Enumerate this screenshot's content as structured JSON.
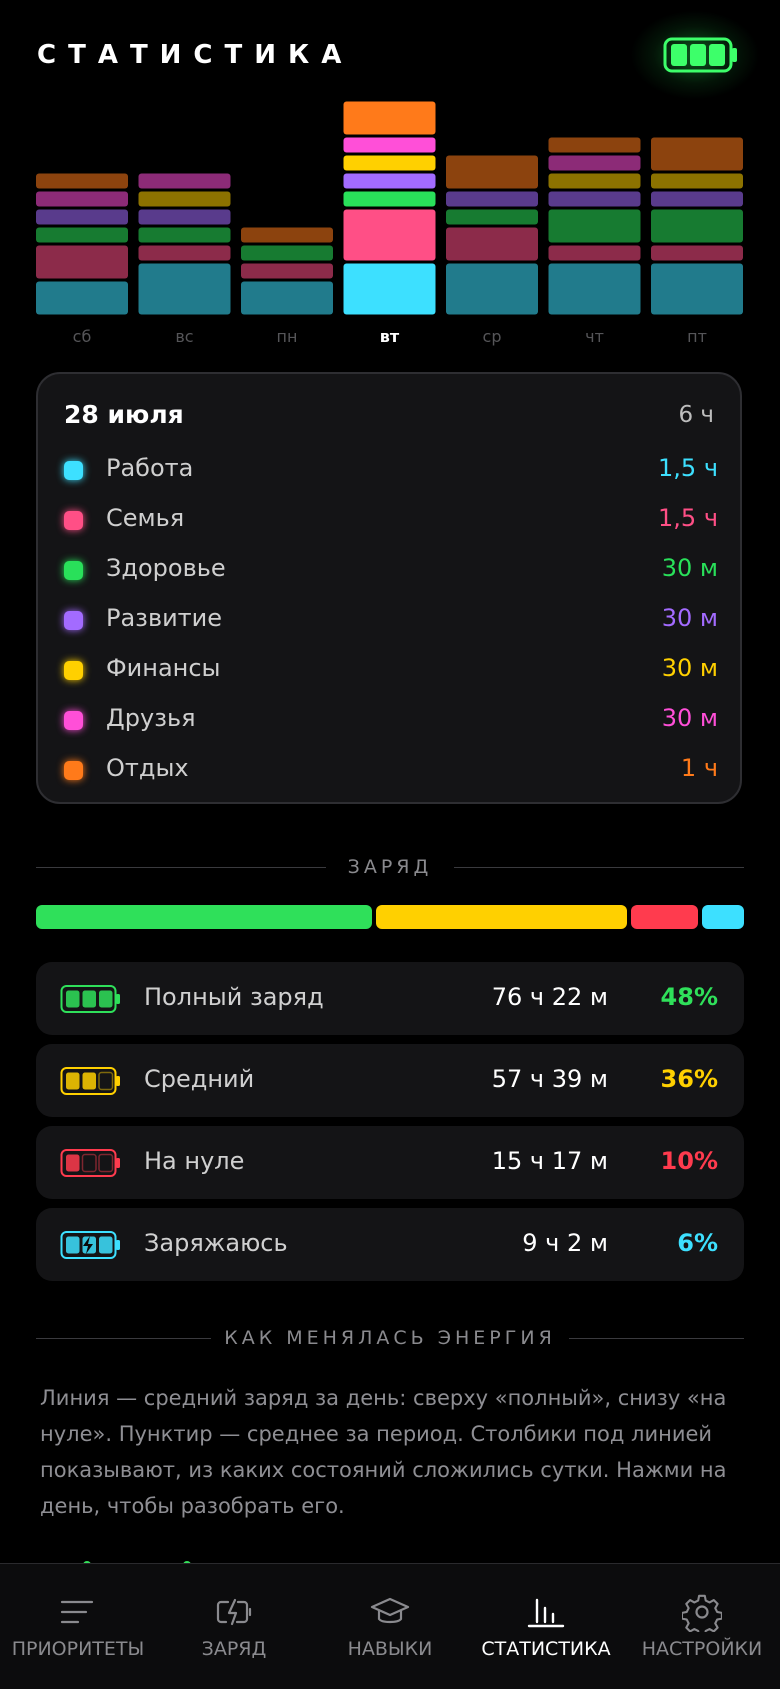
{
  "header": {
    "title": "СТАТИСТИКА"
  },
  "chart_data": {
    "type": "bar",
    "stacked": true,
    "categories": [
      "сб",
      "вс",
      "пн",
      "вт",
      "ср",
      "чт",
      "пт"
    ],
    "selected_index": 3,
    "series": [
      {
        "name": "Работа",
        "color": "#3de0ff",
        "values": [
          1.0,
          1.5,
          1.0,
          1.5,
          1.5,
          1.5,
          1.5
        ]
      },
      {
        "name": "Семья",
        "color": "#ff4f86",
        "values": [
          1.0,
          0.5,
          0.5,
          1.5,
          1.0,
          0.5,
          0.5
        ]
      },
      {
        "name": "Здоровье",
        "color": "#29e05a",
        "values": [
          0.5,
          0.5,
          0.5,
          0.5,
          0.5,
          1.0,
          1.0
        ]
      },
      {
        "name": "Развитие",
        "color": "#a36bff",
        "values": [
          0.5,
          0.5,
          0,
          0.5,
          0.5,
          0.5,
          0.5
        ]
      },
      {
        "name": "Финансы",
        "color": "#ffd000",
        "values": [
          0,
          0.5,
          0,
          0.5,
          0,
          0.5,
          0.5
        ]
      },
      {
        "name": "Друзья",
        "color": "#ff4fd8",
        "values": [
          0.5,
          0.5,
          0,
          0.5,
          0,
          0.5,
          0
        ]
      },
      {
        "name": "Отдых",
        "color": "#ff7a1a",
        "values": [
          0.5,
          0,
          0.5,
          1.0,
          1.0,
          0.5,
          1.0
        ]
      }
    ]
  },
  "day_card": {
    "date": "28 июля",
    "total": "6 ч",
    "items": [
      {
        "label": "Работа",
        "value": "1,5 ч",
        "color": "#3de0ff"
      },
      {
        "label": "Семья",
        "value": "1,5 ч",
        "color": "#ff4f86"
      },
      {
        "label": "Здоровье",
        "value": "30 м",
        "color": "#29e05a"
      },
      {
        "label": "Развитие",
        "value": "30 м",
        "color": "#a36bff"
      },
      {
        "label": "Финансы",
        "value": "30 м",
        "color": "#ffd000"
      },
      {
        "label": "Друзья",
        "value": "30 м",
        "color": "#ff4fd8"
      },
      {
        "label": "Отдых",
        "value": "1 ч",
        "color": "#ff7a1a"
      }
    ]
  },
  "charge": {
    "heading": "ЗАРЯД",
    "shares": [
      {
        "key": "full",
        "percent": 48,
        "color": "#2fe05a"
      },
      {
        "key": "medium",
        "percent": 36,
        "color": "#ffd000"
      },
      {
        "key": "empty",
        "percent": 10,
        "color": "#ff3b4e"
      },
      {
        "key": "charging",
        "percent": 6,
        "color": "#3de0ff"
      }
    ],
    "states": [
      {
        "icon": "battery-full-icon",
        "label": "Полный заряд",
        "time": "76 ч 22 м",
        "pct": "48%",
        "color": "#2fe05a"
      },
      {
        "icon": "battery-medium-icon",
        "label": "Средний",
        "time": "57 ч 39 м",
        "pct": "36%",
        "color": "#ffd000"
      },
      {
        "icon": "battery-empty-icon",
        "label": "На нуле",
        "time": "15 ч 17 м",
        "pct": "10%",
        "color": "#ff3b4e"
      },
      {
        "icon": "battery-charging-icon",
        "label": "Заряжаюсь",
        "time": "9 ч 2 м",
        "pct": "6%",
        "color": "#3de0ff"
      }
    ]
  },
  "energy": {
    "heading": "КАК МЕНЯЛАСЬ ЭНЕРГИЯ",
    "description": "Линия — средний заряд за день: сверху «полный», снизу «на нуле». Пунктир — среднее за период. Столбики под линией показывают, из каких состояний сложились сутки. Нажми на день, чтобы разобрать его."
  },
  "nav": {
    "items": [
      {
        "label": "ПРИОРИТЕТЫ",
        "icon": "menu-icon"
      },
      {
        "label": "ЗАРЯД",
        "icon": "charge-icon"
      },
      {
        "label": "НАВЫКИ",
        "icon": "graduation-cap-icon"
      },
      {
        "label": "СТАТИСТИКА",
        "icon": "bar-chart-icon",
        "active": true
      },
      {
        "label": "НАСТРОЙКИ",
        "icon": "gear-icon"
      }
    ]
  }
}
